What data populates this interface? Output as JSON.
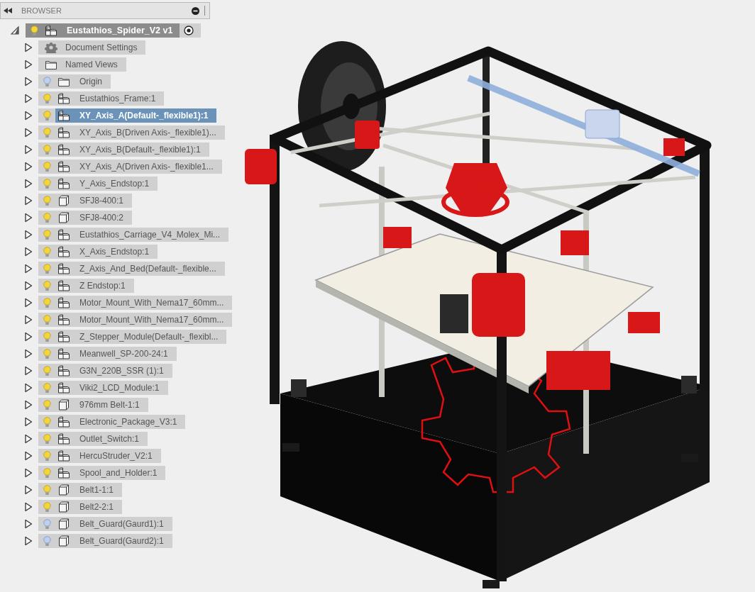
{
  "panel": {
    "title": "BROWSER"
  },
  "root": {
    "label": "Eustathios_Spider_V2 v1",
    "visible": true,
    "expanded": true
  },
  "items": [
    {
      "label": "Document Settings",
      "kind": "settings",
      "expanded": false,
      "selected": false
    },
    {
      "label": "Named Views",
      "kind": "folder",
      "expanded": false,
      "selected": false
    },
    {
      "label": "Origin",
      "kind": "folder",
      "visible": false,
      "expanded": false,
      "selected": false
    },
    {
      "label": "Eustathios_Frame:1",
      "kind": "component",
      "visible": true,
      "expanded": false,
      "selected": false
    },
    {
      "label": "XY_Axis_A(Default-_flexible1):1",
      "kind": "component",
      "visible": true,
      "expanded": false,
      "selected": true
    },
    {
      "label": "XY_Axis_B(Driven Axis-_flexible1)...",
      "kind": "component",
      "visible": true,
      "expanded": false,
      "selected": false
    },
    {
      "label": "XY_Axis_B(Default-_flexible1):1",
      "kind": "component",
      "visible": true,
      "expanded": false,
      "selected": false
    },
    {
      "label": "XY_Axis_A(Driven Axis-_flexible1...",
      "kind": "component",
      "visible": true,
      "expanded": false,
      "selected": false
    },
    {
      "label": "Y_Axis_Endstop:1",
      "kind": "component",
      "visible": true,
      "expanded": false,
      "selected": false
    },
    {
      "label": "SFJ8-400:1",
      "kind": "body",
      "visible": true,
      "expanded": false,
      "selected": false
    },
    {
      "label": "SFJ8-400:2",
      "kind": "body",
      "visible": true,
      "expanded": false,
      "selected": false
    },
    {
      "label": "Eustathios_Carriage_V4_Molex_Mi...",
      "kind": "component",
      "visible": true,
      "expanded": false,
      "selected": false
    },
    {
      "label": "X_Axis_Endstop:1",
      "kind": "component",
      "visible": true,
      "expanded": false,
      "selected": false
    },
    {
      "label": "Z_Axis_And_Bed(Default-_flexible...",
      "kind": "component",
      "visible": true,
      "expanded": false,
      "selected": false
    },
    {
      "label": "Z Endstop:1",
      "kind": "component",
      "visible": true,
      "expanded": false,
      "selected": false
    },
    {
      "label": "Motor_Mount_With_Nema17_60mm...",
      "kind": "component",
      "visible": true,
      "expanded": false,
      "selected": false
    },
    {
      "label": "Motor_Mount_With_Nema17_60mm...",
      "kind": "component",
      "visible": true,
      "expanded": false,
      "selected": false
    },
    {
      "label": "Z_Stepper_Module(Default-_flexibl...",
      "kind": "component",
      "visible": true,
      "expanded": false,
      "selected": false
    },
    {
      "label": "Meanwell_SP-200-24:1",
      "kind": "component",
      "visible": true,
      "expanded": false,
      "selected": false
    },
    {
      "label": "G3N_220B_SSR (1):1",
      "kind": "component",
      "visible": true,
      "expanded": false,
      "selected": false
    },
    {
      "label": "Viki2_LCD_Module:1",
      "kind": "component",
      "visible": true,
      "expanded": false,
      "selected": false
    },
    {
      "label": "976mm Belt-1:1",
      "kind": "body",
      "visible": true,
      "expanded": false,
      "selected": false
    },
    {
      "label": "Electronic_Package_V3:1",
      "kind": "component",
      "visible": true,
      "expanded": false,
      "selected": false
    },
    {
      "label": "Outlet_Switch:1",
      "kind": "component",
      "visible": true,
      "expanded": false,
      "selected": false
    },
    {
      "label": "HercuStruder_V2:1",
      "kind": "component",
      "visible": true,
      "expanded": false,
      "selected": false
    },
    {
      "label": "Spool_and_Holder:1",
      "kind": "component",
      "visible": true,
      "expanded": false,
      "selected": false
    },
    {
      "label": "Belt1-1:1",
      "kind": "body",
      "visible": true,
      "expanded": false,
      "selected": false
    },
    {
      "label": "Belt2-2:1",
      "kind": "body",
      "visible": true,
      "expanded": false,
      "selected": false
    },
    {
      "label": "Belt_Guard(Gaurd1):1",
      "kind": "body",
      "visible": false,
      "expanded": false,
      "selected": false
    },
    {
      "label": "Belt_Guard(Gaurd2):1",
      "kind": "body",
      "visible": false,
      "expanded": false,
      "selected": false
    }
  ]
}
